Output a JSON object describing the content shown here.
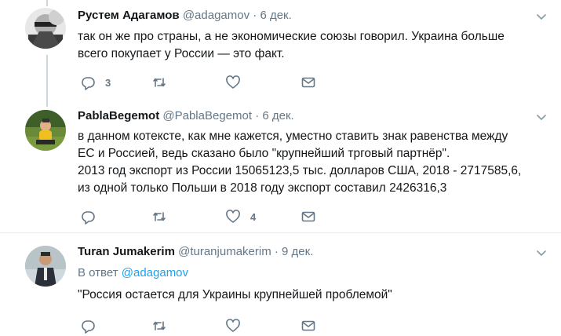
{
  "tweets": [
    {
      "name": "Рустем Адагамов",
      "handle": "@adagamov",
      "dot": "·",
      "date": "6 дек.",
      "lines": [
        "так он же про страны, а не экономические союзы говорил. Украина больше",
        "всего покупает у России — это факт."
      ],
      "reply_count": "3",
      "retweet_count": "",
      "like_count": ""
    },
    {
      "name": "PablaBegemot",
      "handle": "@PablaBegemot",
      "dot": "·",
      "date": "6 дек.",
      "lines": [
        "в данном котексте, как мне кажется, уместно ставить знак равенства между",
        "ЕС и Россией, ведь сказано было \"крупнейший трговый партнёр\".",
        "2013 год экспорт из России 15065123,5 тыс. долларов США, 2018 - 2717585,6,",
        "из одной только Польши в 2018 году экспорт составил 2426316,3"
      ],
      "reply_count": "",
      "retweet_count": "",
      "like_count": "4"
    },
    {
      "name": "Turan Jumakerim",
      "handle": "@turanjumakerim",
      "dot": "·",
      "date": "9 дек.",
      "reply_prefix": "В ответ",
      "reply_handle": "@adagamov",
      "lines": [
        "\"Россия остается для Украины крупнейшей проблемой\""
      ],
      "reply_count": "",
      "retweet_count": "",
      "like_count": ""
    }
  ],
  "icons": {
    "reply": "reply-icon",
    "retweet": "retweet-icon",
    "like": "heart-icon",
    "dm": "envelope-icon",
    "more": "chevron-down-icon"
  },
  "colors": {
    "text": "#14171a",
    "secondary": "#657786",
    "link": "#1da1f2",
    "thread_line": "#ccd6dd",
    "divider": "#e6ecf0"
  }
}
